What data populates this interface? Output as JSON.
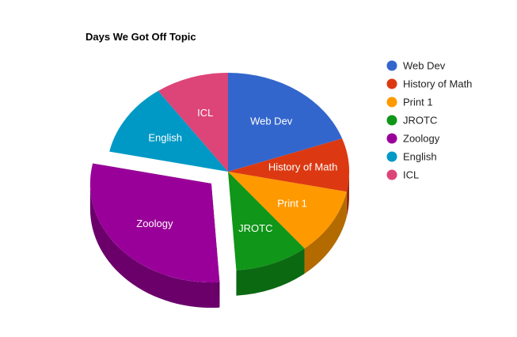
{
  "chart_data": {
    "type": "pie",
    "title": "Days We Got Off Topic",
    "categories": [
      "Web Dev",
      "History of Math",
      "Print 1",
      "JROTC",
      "Zoology",
      "English",
      "ICL"
    ],
    "values": [
      18,
      8,
      10,
      9,
      27,
      11,
      9
    ],
    "colors": [
      "#3366cc",
      "#dc3912",
      "#ff9900",
      "#109618",
      "#990099",
      "#0099c6",
      "#dd4477"
    ],
    "exploded": "Zoology",
    "style": "3d",
    "legend": "right"
  }
}
